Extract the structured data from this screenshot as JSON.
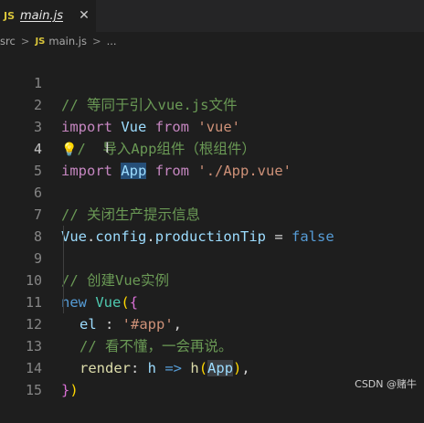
{
  "tab": {
    "badge": "JS",
    "label": "main.js",
    "close": "✕"
  },
  "breadcrumb": {
    "folder": "src",
    "sep": ">",
    "badge": "JS",
    "file": "main.js",
    "rest": "..."
  },
  "lines": [
    {
      "num": "1",
      "cmt": "// 等同于引入vue.js文件"
    },
    {
      "num": "2",
      "kw": "import",
      "cls": "Vue",
      "kw2": "from",
      "str": "'vue'"
    },
    {
      "num": "3",
      "cmt": "/  导入App组件（根组件）"
    },
    {
      "num": "4",
      "kw": "import",
      "cls": "App",
      "kw2": "from",
      "str": "'./App.vue'"
    },
    {
      "num": "5"
    },
    {
      "num": "6",
      "cmt": "// 关闭生产提示信息"
    },
    {
      "num": "7",
      "cls": "Vue",
      "p1": ".",
      "prop1": "config",
      "p2": ".",
      "prop2": "productionTip",
      "op": " = ",
      "bool": "false"
    },
    {
      "num": "8"
    },
    {
      "num": "9",
      "cmt": "// 创建Vue实例"
    },
    {
      "num": "10",
      "kw": "new",
      "cls": "Vue",
      "paren": "(",
      "brace": "{"
    },
    {
      "num": "11",
      "prop": "el",
      "colon": " : ",
      "str": "'#app'",
      "comma": ","
    },
    {
      "num": "12",
      "cmt": "// 看不懂，一会再说。"
    },
    {
      "num": "13",
      "fn1": "render",
      "colon": ": ",
      "param": "h",
      "arrow": " => ",
      "fn": "h",
      "open": "(",
      "arg": "App",
      "close": ")",
      "comma": ","
    },
    {
      "num": "14",
      "brace": "}",
      "paren": ")"
    },
    {
      "num": "15"
    }
  ],
  "watermark": "CSDN @赌牛"
}
